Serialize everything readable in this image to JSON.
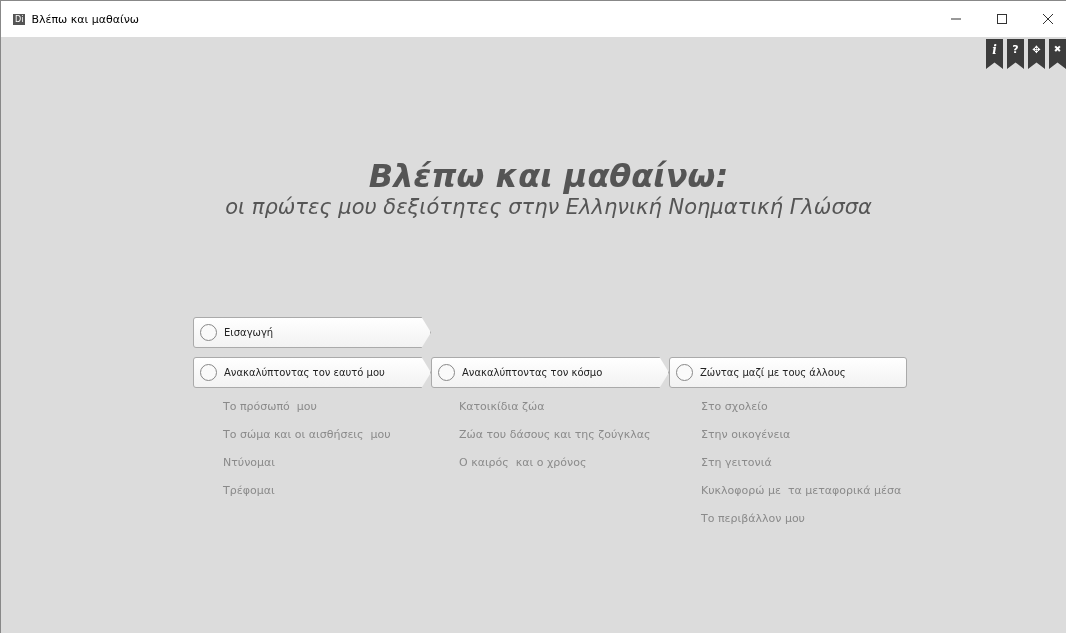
{
  "window": {
    "title": "Βλέπω και μαθαίνω",
    "app_badge": "Di"
  },
  "toolbar": [
    {
      "kind": "info",
      "label": "i"
    },
    {
      "kind": "help",
      "label": "?"
    },
    {
      "kind": "move",
      "label": "✥"
    },
    {
      "kind": "close",
      "label": "✖"
    }
  ],
  "heading": {
    "title": "Βλέπω και μαθαίνω:",
    "subtitle": "οι πρώτες μου δεξιότητες στην Ελληνική Νοηματική Γλώσσα"
  },
  "intro": {
    "label": "Εισαγωγή",
    "checked": false
  },
  "sections": [
    {
      "label": "Ανακαλύπτοντας τον εαυτό μου",
      "checked": false,
      "items": [
        "Το πρόσωπό  μου",
        "Το σώμα και οι αισθήσεις  μου",
        "Ντύνομαι",
        "Τρέφομαι"
      ]
    },
    {
      "label": "Ανακαλύπτοντας τον κόσμο",
      "checked": false,
      "items": [
        "Κατοικίδια ζώα",
        "Ζώα του δάσους και της ζούγκλας",
        "Ο καιρός  και ο χρόνος"
      ]
    },
    {
      "label": "Ζώντας μαζί με τους άλλους",
      "checked": false,
      "items": [
        "Στο σχολείο",
        "Στην οικογένεια",
        "Στη γειτονιά",
        "Κυκλοφορώ με  τα μεταφορικά μέσα",
        "Το περιβάλλον μου"
      ]
    }
  ]
}
